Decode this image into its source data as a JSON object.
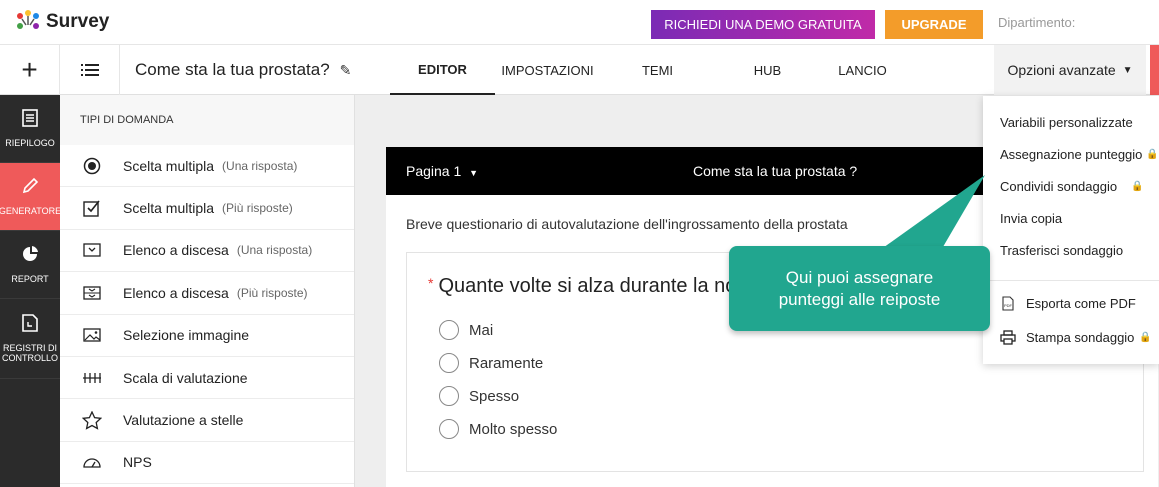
{
  "header": {
    "app_name": "Survey",
    "demo_button": "RICHIEDI UNA DEMO GRATUITA",
    "upgrade_button": "UPGRADE",
    "department_label": "Dipartimento:"
  },
  "subbar": {
    "survey_title": "Come sta la tua prostata?",
    "tabs": [
      {
        "label": "EDITOR",
        "active": true
      },
      {
        "label": "IMPOSTAZIONI",
        "active": false
      },
      {
        "label": "TEMI",
        "active": false
      },
      {
        "label": "HUB",
        "active": false
      },
      {
        "label": "LANCIO",
        "active": false
      }
    ],
    "advanced_options": "Opzioni avanzate"
  },
  "rail": {
    "items": [
      {
        "label": "RIEPILOGO",
        "icon": "document-icon",
        "active": false
      },
      {
        "label": "GENERATORE",
        "icon": "pencil-icon",
        "active": true
      },
      {
        "label": "REPORT",
        "icon": "pie-chart-icon",
        "active": false
      },
      {
        "label": "REGISTRI DI CONTROLLO",
        "icon": "audit-log-icon",
        "active": false
      }
    ]
  },
  "question_types": {
    "heading": "TIPI DI DOMANDA",
    "items": [
      {
        "label": "Scelta multipla",
        "sub": "(Una risposta)",
        "icon": "radio-icon"
      },
      {
        "label": "Scelta multipla",
        "sub": "(Più risposte)",
        "icon": "checkbox-icon"
      },
      {
        "label": "Elenco a discesa",
        "sub": "(Una risposta)",
        "icon": "dropdown-icon"
      },
      {
        "label": "Elenco a discesa",
        "sub": "(Più risposte)",
        "icon": "multi-dropdown-icon"
      },
      {
        "label": "Selezione immagine",
        "sub": "",
        "icon": "image-icon"
      },
      {
        "label": "Scala di valutazione",
        "sub": "",
        "icon": "scale-icon"
      },
      {
        "label": "Valutazione a stelle",
        "sub": "",
        "icon": "star-icon"
      },
      {
        "label": "NPS",
        "sub": "",
        "icon": "gauge-icon"
      }
    ]
  },
  "editor": {
    "page_label": "Pagina 1",
    "page_title": "Come sta la tua prostata ?",
    "description": "Breve questionario di autovalutazione dell'ingrossamento della prostata",
    "question_text": "Quante volte si alza durante la no",
    "required_mark": "*",
    "options": [
      "Mai",
      "Raramente",
      "Spesso",
      "Molto spesso"
    ]
  },
  "menu": {
    "items": [
      {
        "label": "Variabili personalizzate",
        "locked": false
      },
      {
        "label": "Assegnazione punteggio",
        "locked": true
      },
      {
        "label": "Condividi sondaggio",
        "locked": true
      },
      {
        "label": "Invia copia",
        "locked": false
      },
      {
        "label": "Trasferisci sondaggio",
        "locked": false
      }
    ],
    "export_pdf": "Esporta come PDF",
    "print_survey": "Stampa sondaggio",
    "lock_symbol": "🔒"
  },
  "callout": {
    "line1": "Qui puoi assegnare",
    "line2": "punteggi alle reiposte"
  },
  "colors": {
    "accent_red": "#ef5a5a",
    "demo_purple": "#8e24aa",
    "upgrade_orange": "#f39c2a",
    "callout_teal": "#21a68f",
    "rail_dark": "#2b2b2b"
  }
}
